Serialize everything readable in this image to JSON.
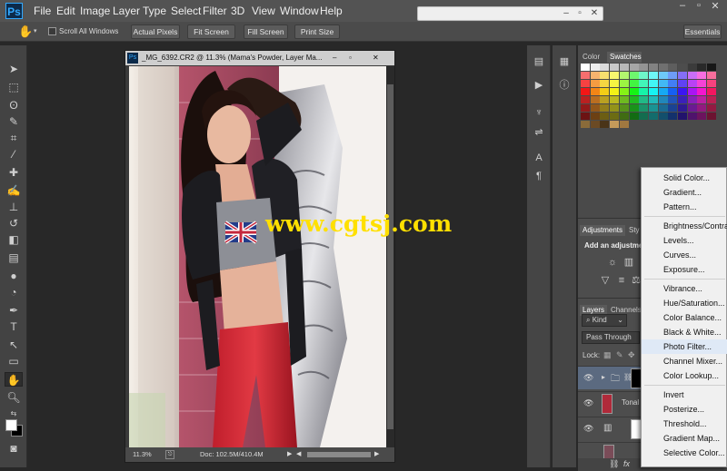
{
  "menubar": {
    "logo": "Ps",
    "items": [
      "File",
      "Edit",
      "Image",
      "Layer",
      "Type",
      "Select",
      "Filter",
      "3D",
      "View",
      "Window",
      "Help"
    ]
  },
  "options_bar": {
    "scroll_all_windows": "Scroll All Windows",
    "buttons": [
      "Actual Pixels",
      "Fit Screen",
      "Fill Screen",
      "Print Size"
    ],
    "workspace": "Essentials"
  },
  "document": {
    "tab_icon": "Ps",
    "title": "_MG_6392.CR2 @ 11.3% (Mama's Powder, Layer Ma...",
    "zoom": "11.3%",
    "doc_info": "Doc: 102.5M/410.4M"
  },
  "right_panel": {
    "color_tabs": [
      "Color",
      "Swatches"
    ],
    "adjustments_tabs": [
      "Adjustments",
      "Sty"
    ],
    "adjustments_hint": "Add an adjustmen",
    "layers_tabs": [
      "Layers",
      "Channels"
    ],
    "kind_filter": "Kind",
    "blend_mode": "Pass Through",
    "lock_label": "Lock:",
    "layer_names": [
      "",
      "Tonal"
    ]
  },
  "adjustment_menu": {
    "groups": [
      [
        "Solid Color...",
        "Gradient...",
        "Pattern..."
      ],
      [
        "Brightness/Contrast...",
        "Levels...",
        "Curves...",
        "Exposure..."
      ],
      [
        "Vibrance...",
        "Hue/Saturation...",
        "Color Balance...",
        "Black & White...",
        "Photo Filter...",
        "Channel Mixer...",
        "Color Lookup..."
      ],
      [
        "Invert",
        "Posterize...",
        "Threshold...",
        "Gradient Map...",
        "Selective Color..."
      ]
    ],
    "highlighted": "Photo Filter..."
  },
  "watermark": "www.cgtsj.com",
  "colors": {
    "menubar": "#535353",
    "workspace": "#282828",
    "menu_highlight": "#dfe9f6",
    "watermark": "#ffe000"
  }
}
